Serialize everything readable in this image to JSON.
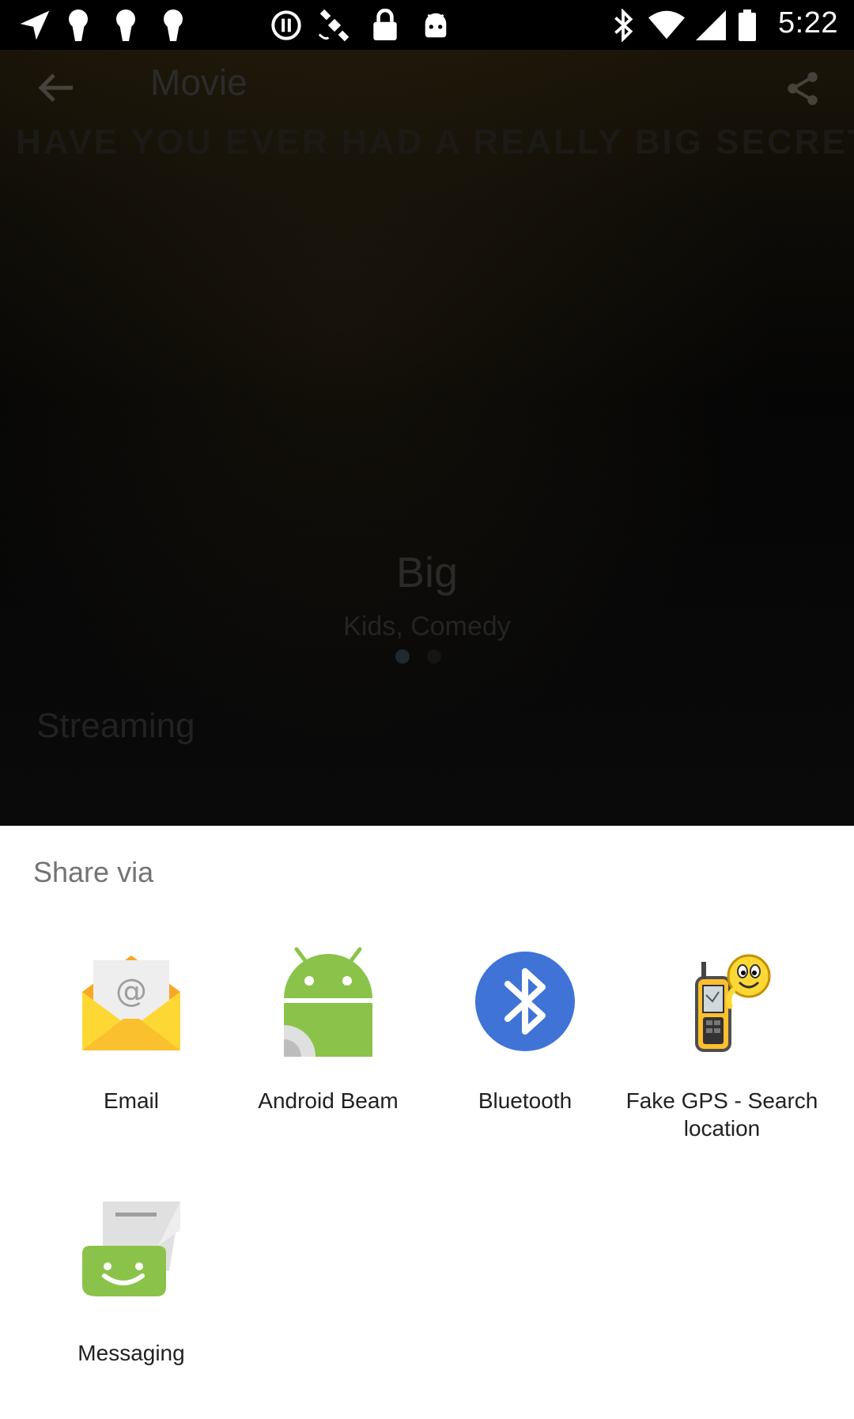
{
  "status_bar": {
    "time": "5:22",
    "icons": [
      "navigation-icon",
      "keyhole-icon",
      "keyhole-icon",
      "keyhole-icon",
      "do-not-disturb-icon",
      "fake-gps-satellite-icon",
      "lock-icon",
      "android-icon",
      "bluetooth-icon",
      "wifi-icon",
      "signal-icon",
      "battery-icon"
    ]
  },
  "background_app": {
    "title": "Movie",
    "tagline": "HAVE YOU EVER HAD A REALLY BIG SECRET?",
    "movie_title": "Big",
    "genres": "Kids, Comedy",
    "section": "Streaming"
  },
  "share_sheet": {
    "title": "Share via",
    "targets": [
      {
        "label": "Email",
        "icon": "email-icon"
      },
      {
        "label": "Android Beam",
        "icon": "android-beam-icon"
      },
      {
        "label": "Bluetooth",
        "icon": "bluetooth-icon"
      },
      {
        "label": "Fake GPS - Search location",
        "icon": "fake-gps-icon"
      },
      {
        "label": "Messaging",
        "icon": "messaging-icon"
      }
    ]
  },
  "colors": {
    "sheet_background": "#ffffff",
    "title_text": "#737373",
    "label_text": "#212121",
    "bluetooth_blue": "#3f74d6",
    "android_green": "#8bc34a",
    "email_yellow": "#fbc02d",
    "messaging_green": "#8bc34a"
  }
}
